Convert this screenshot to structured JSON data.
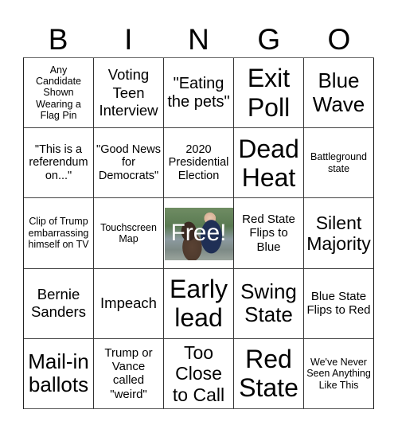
{
  "title_letters": [
    "B",
    "I",
    "N",
    "G",
    "O"
  ],
  "free_space": {
    "label": "Free!",
    "image_description": "photo of a man in a navy suit embracing a pregnant woman outdoors"
  },
  "rows": [
    [
      "Any Candidate Shown Wearing a Flag Pin",
      "Voting Teen Interview",
      "\"Eating the pets\"",
      "Exit Poll",
      "Blue Wave"
    ],
    [
      "\"This is a referendum on...\"",
      "\"Good News for Democrats\"",
      "2020 Presidential Election",
      "Dead Heat",
      "Battleground state"
    ],
    [
      "Clip of Trump embarrassing himself on TV",
      "Touchscreen Map",
      "Free!",
      "Red State Flips to Blue",
      "Silent Majority"
    ],
    [
      "Bernie Sanders",
      "Impeach",
      "Early lead",
      "Swing State",
      "Blue State Flips to Red"
    ],
    [
      "Mail-in ballots",
      "Trump or Vance called \"weird\"",
      "Too Close to Call",
      "Red State",
      "We've Never Seen Anything Like This"
    ]
  ]
}
